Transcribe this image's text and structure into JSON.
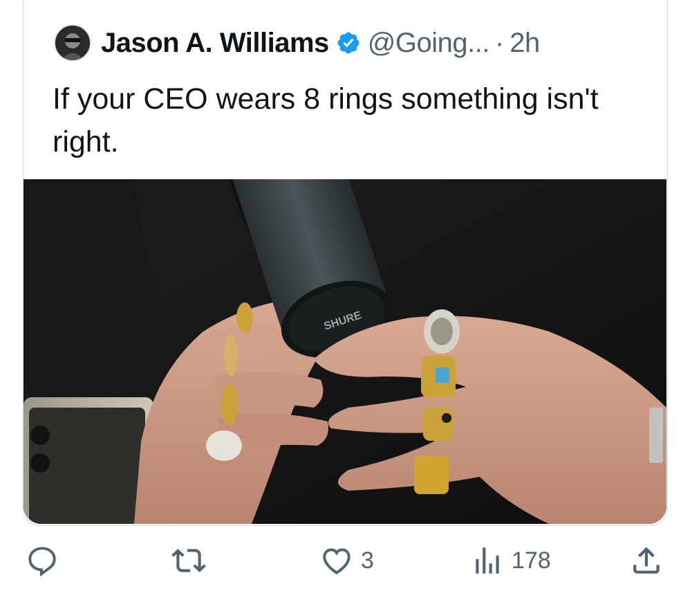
{
  "tweet": {
    "author_name": "Jason A. Williams",
    "handle": "@Going...",
    "separator": "·",
    "time_ago": "2h",
    "text": "If your CEO wears 8 rings something isn't right.",
    "image_caption_mark": "SHURE",
    "image_icon": "photo-hands-microphone"
  },
  "actions": {
    "reply": {
      "icon": "reply-icon",
      "count": ""
    },
    "retweet": {
      "icon": "retweet-icon",
      "count": ""
    },
    "like": {
      "icon": "heart-icon",
      "count": "3"
    },
    "views": {
      "icon": "views-icon",
      "count": "178"
    },
    "share": {
      "icon": "share-icon",
      "count": ""
    }
  },
  "colors": {
    "verified_badge": "#1d9bf0",
    "secondary_text": "#536471",
    "primary_text": "#0f1419",
    "border": "#cfd9de"
  }
}
